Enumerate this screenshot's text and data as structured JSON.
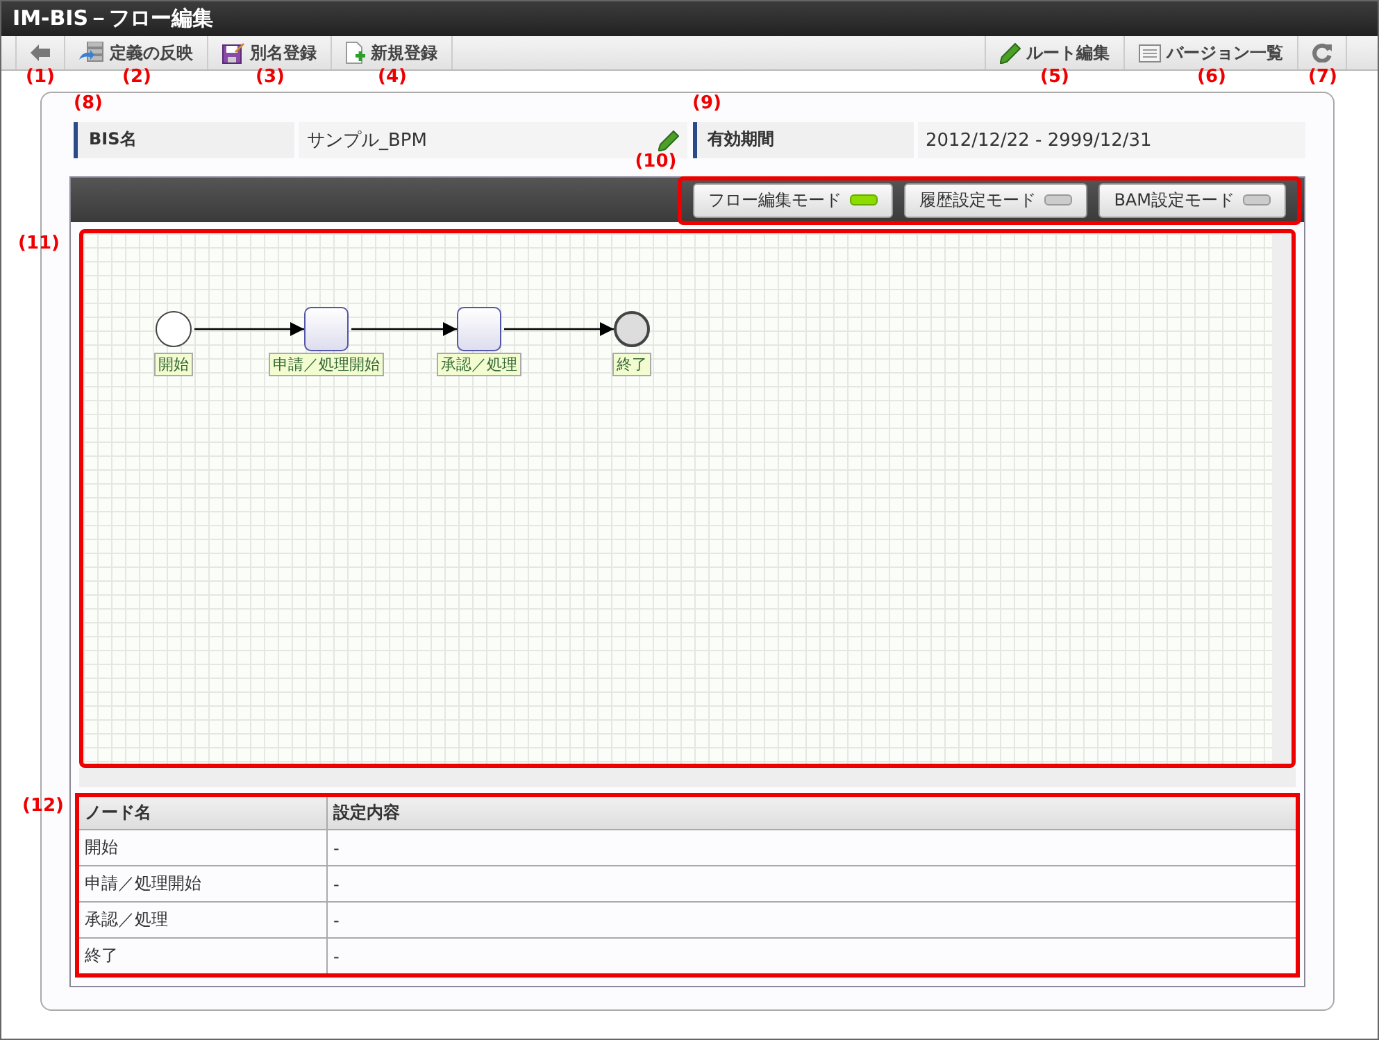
{
  "window": {
    "title": "IM-BIS－フロー編集"
  },
  "toolbar": {
    "left": [
      {
        "kind": "back",
        "callout": "(1)"
      },
      {
        "kind": "deploy",
        "label": "定義の反映",
        "callout": "(2)"
      },
      {
        "kind": "save-as",
        "label": "別名登録",
        "callout": "(3)"
      },
      {
        "kind": "new",
        "label": "新規登録",
        "callout": "(4)"
      }
    ],
    "right": [
      {
        "kind": "pencil",
        "label": "ルート編集",
        "callout": "(5)"
      },
      {
        "kind": "list",
        "label": "バージョン一覧",
        "callout": "(6)"
      },
      {
        "kind": "refresh",
        "callout": "(7)"
      }
    ]
  },
  "info": [
    {
      "label": "BIS名",
      "value": "サンプル_BPM",
      "editable": true,
      "callout": "(8)"
    },
    {
      "label": "有効期間",
      "value": "2012/12/22 - 2999/12/31",
      "editable": false,
      "callout": "(9)"
    }
  ],
  "modes": {
    "callout": "(10)",
    "items": [
      {
        "label": "フロー編集モード",
        "on": true
      },
      {
        "label": "履歴設定モード",
        "on": false
      },
      {
        "label": "BAM設定モード",
        "on": false
      }
    ]
  },
  "canvas": {
    "callout": "(11)",
    "nodes": [
      {
        "kind": "start",
        "label": "開始"
      },
      {
        "kind": "task",
        "label": "申請／処理開始"
      },
      {
        "kind": "task",
        "label": "承認／処理"
      },
      {
        "kind": "end",
        "label": "終了"
      }
    ]
  },
  "table": {
    "callout": "(12)",
    "columns": [
      "ノード名",
      "設定内容"
    ],
    "rows": [
      [
        "開始",
        "-"
      ],
      [
        "申請／処理開始",
        "-"
      ],
      [
        "承認／処理",
        "-"
      ],
      [
        "終了",
        "-"
      ]
    ]
  }
}
